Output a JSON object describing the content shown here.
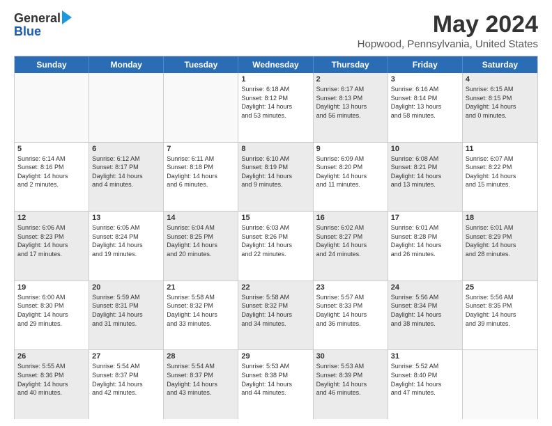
{
  "logo": {
    "line1": "General",
    "line2": "Blue"
  },
  "title": "May 2024",
  "subtitle": "Hopwood, Pennsylvania, United States",
  "days": [
    "Sunday",
    "Monday",
    "Tuesday",
    "Wednesday",
    "Thursday",
    "Friday",
    "Saturday"
  ],
  "weeks": [
    [
      {
        "day": "",
        "info": "",
        "shaded": false,
        "empty": true
      },
      {
        "day": "",
        "info": "",
        "shaded": false,
        "empty": true
      },
      {
        "day": "",
        "info": "",
        "shaded": false,
        "empty": true
      },
      {
        "day": "1",
        "info": "Sunrise: 6:18 AM\nSunset: 8:12 PM\nDaylight: 14 hours\nand 53 minutes.",
        "shaded": false,
        "empty": false
      },
      {
        "day": "2",
        "info": "Sunrise: 6:17 AM\nSunset: 8:13 PM\nDaylight: 13 hours\nand 56 minutes.",
        "shaded": true,
        "empty": false
      },
      {
        "day": "3",
        "info": "Sunrise: 6:16 AM\nSunset: 8:14 PM\nDaylight: 13 hours\nand 58 minutes.",
        "shaded": false,
        "empty": false
      },
      {
        "day": "4",
        "info": "Sunrise: 6:15 AM\nSunset: 8:15 PM\nDaylight: 14 hours\nand 0 minutes.",
        "shaded": true,
        "empty": false
      }
    ],
    [
      {
        "day": "5",
        "info": "Sunrise: 6:14 AM\nSunset: 8:16 PM\nDaylight: 14 hours\nand 2 minutes.",
        "shaded": false,
        "empty": false
      },
      {
        "day": "6",
        "info": "Sunrise: 6:12 AM\nSunset: 8:17 PM\nDaylight: 14 hours\nand 4 minutes.",
        "shaded": true,
        "empty": false
      },
      {
        "day": "7",
        "info": "Sunrise: 6:11 AM\nSunset: 8:18 PM\nDaylight: 14 hours\nand 6 minutes.",
        "shaded": false,
        "empty": false
      },
      {
        "day": "8",
        "info": "Sunrise: 6:10 AM\nSunset: 8:19 PM\nDaylight: 14 hours\nand 9 minutes.",
        "shaded": true,
        "empty": false
      },
      {
        "day": "9",
        "info": "Sunrise: 6:09 AM\nSunset: 8:20 PM\nDaylight: 14 hours\nand 11 minutes.",
        "shaded": false,
        "empty": false
      },
      {
        "day": "10",
        "info": "Sunrise: 6:08 AM\nSunset: 8:21 PM\nDaylight: 14 hours\nand 13 minutes.",
        "shaded": true,
        "empty": false
      },
      {
        "day": "11",
        "info": "Sunrise: 6:07 AM\nSunset: 8:22 PM\nDaylight: 14 hours\nand 15 minutes.",
        "shaded": false,
        "empty": false
      }
    ],
    [
      {
        "day": "12",
        "info": "Sunrise: 6:06 AM\nSunset: 8:23 PM\nDaylight: 14 hours\nand 17 minutes.",
        "shaded": true,
        "empty": false
      },
      {
        "day": "13",
        "info": "Sunrise: 6:05 AM\nSunset: 8:24 PM\nDaylight: 14 hours\nand 19 minutes.",
        "shaded": false,
        "empty": false
      },
      {
        "day": "14",
        "info": "Sunrise: 6:04 AM\nSunset: 8:25 PM\nDaylight: 14 hours\nand 20 minutes.",
        "shaded": true,
        "empty": false
      },
      {
        "day": "15",
        "info": "Sunrise: 6:03 AM\nSunset: 8:26 PM\nDaylight: 14 hours\nand 22 minutes.",
        "shaded": false,
        "empty": false
      },
      {
        "day": "16",
        "info": "Sunrise: 6:02 AM\nSunset: 8:27 PM\nDaylight: 14 hours\nand 24 minutes.",
        "shaded": true,
        "empty": false
      },
      {
        "day": "17",
        "info": "Sunrise: 6:01 AM\nSunset: 8:28 PM\nDaylight: 14 hours\nand 26 minutes.",
        "shaded": false,
        "empty": false
      },
      {
        "day": "18",
        "info": "Sunrise: 6:01 AM\nSunset: 8:29 PM\nDaylight: 14 hours\nand 28 minutes.",
        "shaded": true,
        "empty": false
      }
    ],
    [
      {
        "day": "19",
        "info": "Sunrise: 6:00 AM\nSunset: 8:30 PM\nDaylight: 14 hours\nand 29 minutes.",
        "shaded": false,
        "empty": false
      },
      {
        "day": "20",
        "info": "Sunrise: 5:59 AM\nSunset: 8:31 PM\nDaylight: 14 hours\nand 31 minutes.",
        "shaded": true,
        "empty": false
      },
      {
        "day": "21",
        "info": "Sunrise: 5:58 AM\nSunset: 8:32 PM\nDaylight: 14 hours\nand 33 minutes.",
        "shaded": false,
        "empty": false
      },
      {
        "day": "22",
        "info": "Sunrise: 5:58 AM\nSunset: 8:32 PM\nDaylight: 14 hours\nand 34 minutes.",
        "shaded": true,
        "empty": false
      },
      {
        "day": "23",
        "info": "Sunrise: 5:57 AM\nSunset: 8:33 PM\nDaylight: 14 hours\nand 36 minutes.",
        "shaded": false,
        "empty": false
      },
      {
        "day": "24",
        "info": "Sunrise: 5:56 AM\nSunset: 8:34 PM\nDaylight: 14 hours\nand 38 minutes.",
        "shaded": true,
        "empty": false
      },
      {
        "day": "25",
        "info": "Sunrise: 5:56 AM\nSunset: 8:35 PM\nDaylight: 14 hours\nand 39 minutes.",
        "shaded": false,
        "empty": false
      }
    ],
    [
      {
        "day": "26",
        "info": "Sunrise: 5:55 AM\nSunset: 8:36 PM\nDaylight: 14 hours\nand 40 minutes.",
        "shaded": true,
        "empty": false
      },
      {
        "day": "27",
        "info": "Sunrise: 5:54 AM\nSunset: 8:37 PM\nDaylight: 14 hours\nand 42 minutes.",
        "shaded": false,
        "empty": false
      },
      {
        "day": "28",
        "info": "Sunrise: 5:54 AM\nSunset: 8:37 PM\nDaylight: 14 hours\nand 43 minutes.",
        "shaded": true,
        "empty": false
      },
      {
        "day": "29",
        "info": "Sunrise: 5:53 AM\nSunset: 8:38 PM\nDaylight: 14 hours\nand 44 minutes.",
        "shaded": false,
        "empty": false
      },
      {
        "day": "30",
        "info": "Sunrise: 5:53 AM\nSunset: 8:39 PM\nDaylight: 14 hours\nand 46 minutes.",
        "shaded": true,
        "empty": false
      },
      {
        "day": "31",
        "info": "Sunrise: 5:52 AM\nSunset: 8:40 PM\nDaylight: 14 hours\nand 47 minutes.",
        "shaded": false,
        "empty": false
      },
      {
        "day": "",
        "info": "",
        "shaded": false,
        "empty": true
      }
    ]
  ]
}
